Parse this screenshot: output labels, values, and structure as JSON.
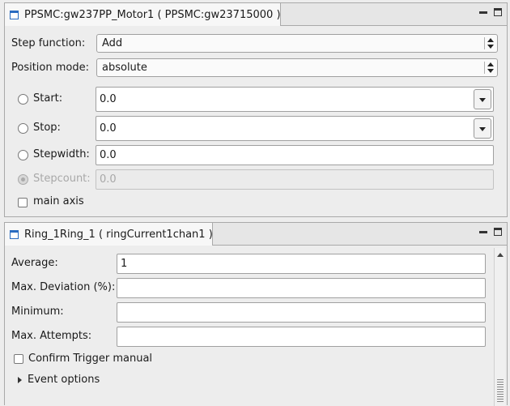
{
  "motor_view": {
    "tab_title": "PPSMC:gw237PP_Motor1  ( PPSMC:gw23715000 )",
    "step_function": {
      "label": "Step function:",
      "value": "Add"
    },
    "position_mode": {
      "label": "Position mode:",
      "value": "absolute"
    },
    "start": {
      "label": "Start:",
      "value": "0.0"
    },
    "stop": {
      "label": "Stop:",
      "value": "0.0"
    },
    "stepwidth": {
      "label": "Stepwidth:",
      "value": "0.0"
    },
    "stepcount": {
      "label": "Stepcount:",
      "value": "0.0"
    },
    "main_axis": {
      "label": "main axis",
      "checked": false
    }
  },
  "detector_view": {
    "tab_title": "Ring_1Ring_1  ( ringCurrent1chan1 )",
    "average": {
      "label": "Average:",
      "value": "1"
    },
    "max_deviation": {
      "label": "Max. Deviation (%):",
      "value": ""
    },
    "minimum": {
      "label": "Minimum:",
      "value": ""
    },
    "max_attempts": {
      "label": "Max. Attempts:",
      "value": ""
    },
    "confirm_trigger": {
      "label": "Confirm Trigger manual",
      "checked": false
    },
    "event_options": {
      "label": "Event options",
      "expanded": false
    }
  }
}
